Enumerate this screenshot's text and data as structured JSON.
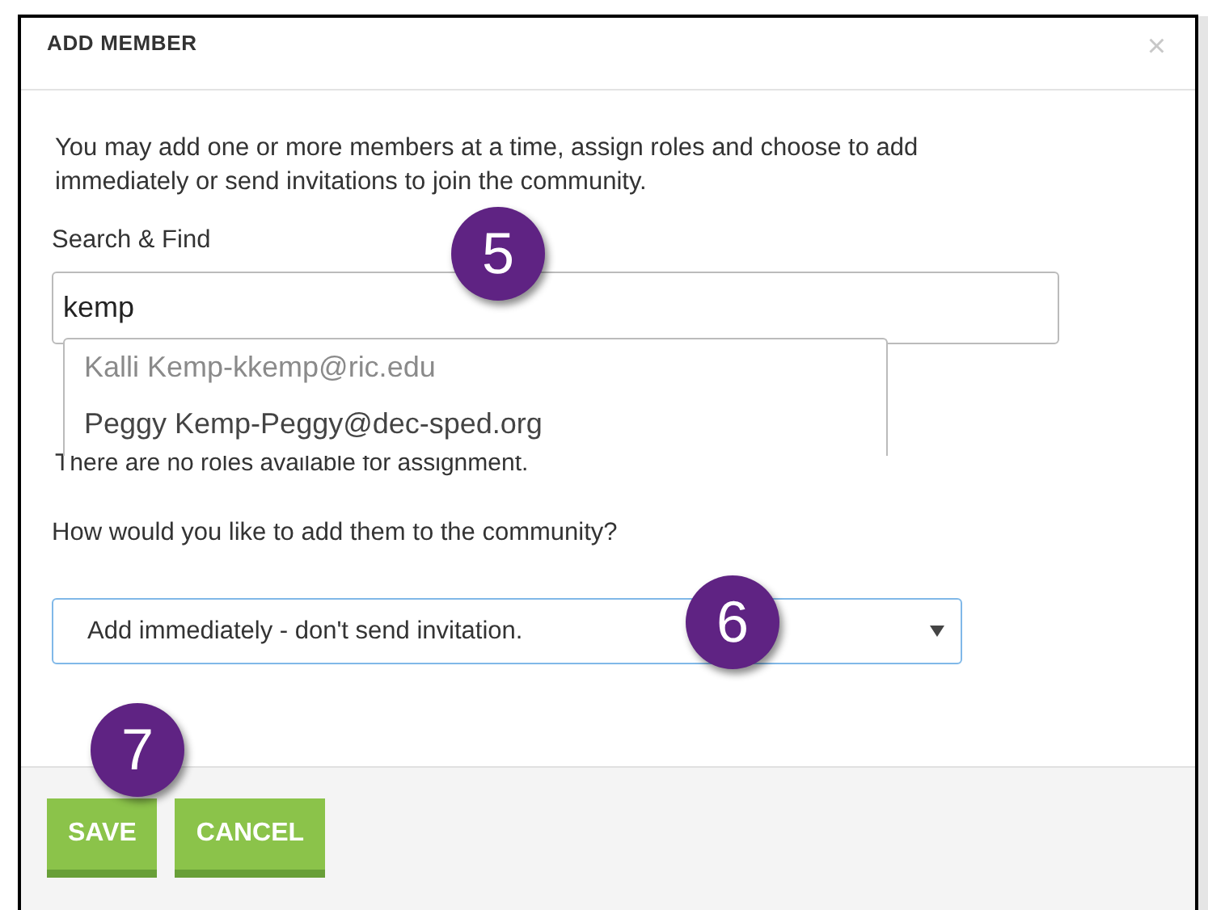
{
  "dialog": {
    "title": "ADD MEMBER",
    "close": "×"
  },
  "intro": "You may add one or more members at a time, assign roles and choose to add immediately or send invitations to join the community.",
  "search": {
    "label": "Search & Find",
    "value": "kemp"
  },
  "suggestions": [
    "Kalli Kemp-kkemp@ric.edu",
    "Peggy Kemp-Peggy@dec-sped.org"
  ],
  "roles_note": "There are no roles available for assignment.",
  "add_method": {
    "label": "How would you like to add them to the community?",
    "value": "Add immediately - don't send invitation."
  },
  "buttons": [
    "SAVE",
    "CANCEL"
  ],
  "callouts": [
    "5",
    "6",
    "7"
  ]
}
